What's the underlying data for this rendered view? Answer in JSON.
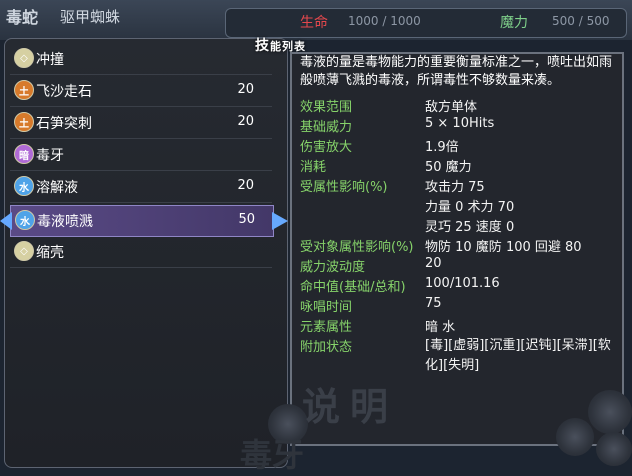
{
  "top": {
    "char_name": "毒蛇",
    "class_name": "驱甲蜘蛛",
    "hp_label": "生命",
    "hp_value": "1000 / 1000",
    "mp_label": "魔力",
    "mp_value": "500 / 500"
  },
  "list": {
    "title_big": "技",
    "title_small": "能列表",
    "items": [
      {
        "name": "冲撞",
        "cost": "",
        "icon": "diamond-icon",
        "icon_char": "◇",
        "icon_color": "#d6d0a2"
      },
      {
        "name": "飞沙走石",
        "cost": "20",
        "icon": "earth-icon",
        "icon_char": "土",
        "icon_color": "#d77a2b"
      },
      {
        "name": "石笋突刺",
        "cost": "20",
        "icon": "earth-icon",
        "icon_char": "土",
        "icon_color": "#d77a2b"
      },
      {
        "name": "毒牙",
        "cost": "",
        "icon": "poison-icon",
        "icon_char": "暗",
        "icon_color": "#b06ad6"
      },
      {
        "name": "溶解液",
        "cost": "20",
        "icon": "water-icon",
        "icon_char": "水",
        "icon_color": "#4fa3e8"
      },
      {
        "name": "毒液喷溅",
        "cost": "50",
        "icon": "water-icon",
        "icon_char": "水",
        "icon_color": "#4fa3e8"
      },
      {
        "name": "缩壳",
        "cost": "",
        "icon": "diamond-icon",
        "icon_char": "◇",
        "icon_color": "#d6d0a2"
      }
    ]
  },
  "desc": {
    "text": "毒液的量是毒物能力的重要衡量标准之一，喷吐出如雨般喷薄飞溅的毒液，所谓毒性不够数量来凑。",
    "props": [
      {
        "label": "效果范围",
        "value": "敌方单体"
      },
      {
        "label": "基础威力",
        "value": "5 × 10Hits"
      },
      {
        "label": "伤害放大",
        "value": "1.9倍"
      },
      {
        "label": "消耗",
        "value": "50      魔力"
      },
      {
        "label": "受属性影响(%)",
        "value": "攻击力 75"
      },
      {
        "label": "",
        "value": "力量  0  术力  70"
      },
      {
        "label": "",
        "value": "灵巧  25  速度  0"
      },
      {
        "label": "受对象属性影响(%)",
        "value": "物防  10  魔防  100  回避  80"
      },
      {
        "label": "威力波动度",
        "value": "20"
      },
      {
        "label": "命中值(基础/总和)",
        "value": "100/101.16"
      },
      {
        "label": "咏唱时间",
        "value": "75"
      },
      {
        "label": "元素属性",
        "value": "暗 水"
      },
      {
        "label": "附加状态",
        "value": "[毒][虚弱][沉重][迟钝][呆滞][软化][失明]"
      }
    ],
    "watermark": "说明",
    "watermark2": "毒牙"
  }
}
